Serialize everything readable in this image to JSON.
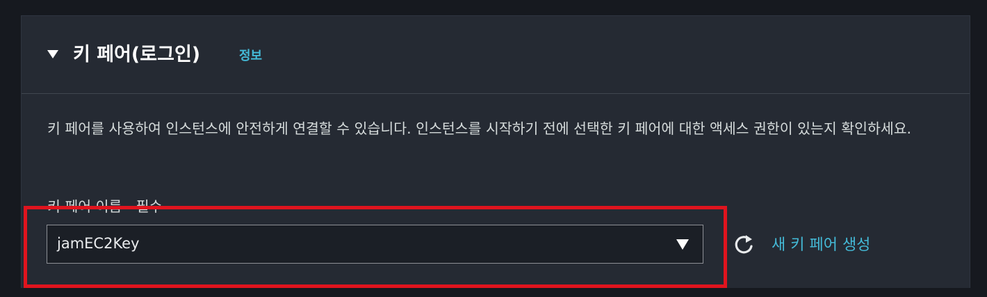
{
  "section": {
    "title": "키 페어(로그인)",
    "info_link": "정보",
    "description": "키 페어를 사용하여 인스턴스에 안전하게 연결할 수 있습니다. 인스턴스를 시작하기 전에 선택한 키 페어에 대한 액세스 권한이 있는지 확인하세요."
  },
  "key_pair_field": {
    "label": "키 페어 이름 - 필수",
    "selected_value": "jamEC2Key"
  },
  "actions": {
    "refresh_icon": "refresh-icon",
    "create_new_label": "새 키 페어 생성"
  },
  "colors": {
    "background": "#16191f",
    "panel": "#252a33",
    "link": "#44b9d6",
    "highlight": "#e0141e"
  }
}
